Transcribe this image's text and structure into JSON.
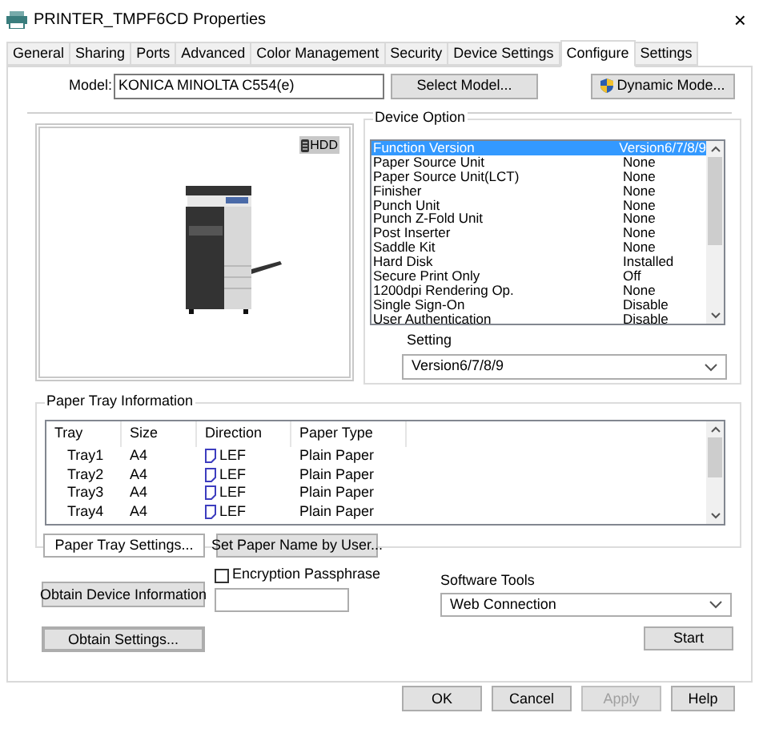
{
  "window": {
    "title": "PRINTER_TMPF6CD Properties",
    "close": "×"
  },
  "tabs": [
    {
      "label": "General",
      "selected": false
    },
    {
      "label": "Sharing",
      "selected": false
    },
    {
      "label": "Ports",
      "selected": false
    },
    {
      "label": "Advanced",
      "selected": false
    },
    {
      "label": "Color Management",
      "selected": false
    },
    {
      "label": "Security",
      "selected": false
    },
    {
      "label": "Device Settings",
      "selected": false
    },
    {
      "label": "Configure",
      "selected": true
    },
    {
      "label": "Settings",
      "selected": false
    }
  ],
  "model": {
    "label": "Model:",
    "value": "KONICA MINOLTA C554(e)",
    "select_button": "Select Model...",
    "dynamic_button": "Dynamic Mode..."
  },
  "preview": {
    "badge": "HDD"
  },
  "device_option": {
    "title": "Device Option",
    "items": [
      {
        "name": "Function Version",
        "value": "Version6/7/8/9",
        "selected": true
      },
      {
        "name": "Paper Source Unit",
        "value": "None",
        "selected": false
      },
      {
        "name": "Paper Source Unit(LCT)",
        "value": "None",
        "selected": false
      },
      {
        "name": "Finisher",
        "value": "None",
        "selected": false
      },
      {
        "name": "Punch Unit",
        "value": "None",
        "selected": false
      },
      {
        "name": "Punch Z-Fold Unit",
        "value": "None",
        "selected": false
      },
      {
        "name": "Post Inserter",
        "value": "None",
        "selected": false
      },
      {
        "name": "Saddle Kit",
        "value": "None",
        "selected": false
      },
      {
        "name": "Hard Disk",
        "value": "Installed",
        "selected": false
      },
      {
        "name": "Secure Print Only",
        "value": "Off",
        "selected": false
      },
      {
        "name": "1200dpi Rendering Op.",
        "value": "None",
        "selected": false
      },
      {
        "name": "Single Sign-On",
        "value": "Disable",
        "selected": false
      },
      {
        "name": "User Authentication",
        "value": "Disable",
        "selected": false
      }
    ],
    "setting_label": "Setting",
    "setting_value": "Version6/7/8/9"
  },
  "paper_tray": {
    "title": "Paper Tray Information",
    "columns": [
      "Tray",
      "Size",
      "Direction",
      "Paper Type"
    ],
    "rows": [
      {
        "tray": "Tray1",
        "size": "A4",
        "direction": "LEF",
        "paper_type": "Plain Paper"
      },
      {
        "tray": "Tray2",
        "size": "A4",
        "direction": "LEF",
        "paper_type": "Plain Paper"
      },
      {
        "tray": "Tray3",
        "size": "A4",
        "direction": "LEF",
        "paper_type": "Plain Paper"
      },
      {
        "tray": "Tray4",
        "size": "A4",
        "direction": "LEF",
        "paper_type": "Plain Paper"
      }
    ],
    "buttons": [
      "Paper Tray Settings...",
      "Set Paper Name by User..."
    ]
  },
  "obtain_device_button": "Obtain Device Information",
  "encryption": {
    "label": "Encryption Passphrase",
    "checked": false
  },
  "software_tools": {
    "label": "Software Tools",
    "value": "Web Connection",
    "start_button": "Start"
  },
  "obtain_settings": {
    "label": "Obtain Settings...",
    "focused": true
  },
  "footer_buttons": [
    {
      "label": "OK",
      "disabled": false
    },
    {
      "label": "Cancel",
      "disabled": false
    },
    {
      "label": "Apply",
      "disabled": true
    },
    {
      "label": "Help",
      "disabled": false
    }
  ]
}
